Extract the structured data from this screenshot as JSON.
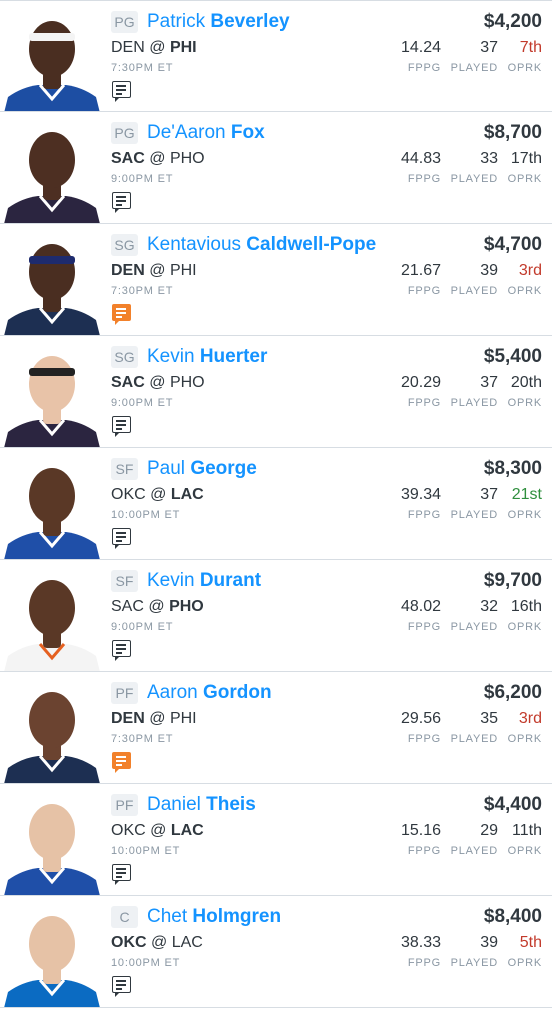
{
  "labels": {
    "fppg": "FPPG",
    "played": "PLAYED",
    "oprk": "OPRK"
  },
  "colors": {
    "jersey": {
      "PHI": "#1d4ea3",
      "SAC": "#2b2540",
      "DEN": "#1d2f52",
      "LAC": "#1f4fa8",
      "PHO": "#f4f4f4",
      "OKC": "#0b6bc2"
    }
  },
  "players": [
    {
      "position": "PG",
      "first": "Patrick",
      "last": "Beverley",
      "salary": "$4,200",
      "away": "DEN",
      "sep": "@",
      "home": "PHI",
      "bold": "home",
      "time": "7:30PM ET",
      "fppg": "14.24",
      "played": "37",
      "oprk": "7th",
      "oprk_tone": "bad",
      "note_active": false,
      "team": "PHI",
      "headband": "white",
      "skin": "#4a2e21"
    },
    {
      "position": "PG",
      "first": "De'Aaron",
      "last": "Fox",
      "salary": "$8,700",
      "away": "SAC",
      "sep": "@",
      "home": "PHO",
      "bold": "away",
      "time": "9:00PM ET",
      "fppg": "44.83",
      "played": "33",
      "oprk": "17th",
      "oprk_tone": "neutral",
      "note_active": false,
      "team": "SAC",
      "headband": "",
      "skin": "#4d2f22"
    },
    {
      "position": "SG",
      "first": "Kentavious",
      "last": "Caldwell-Pope",
      "salary": "$4,700",
      "away": "DEN",
      "sep": "@",
      "home": "PHI",
      "bold": "away",
      "time": "7:30PM ET",
      "fppg": "21.67",
      "played": "39",
      "oprk": "3rd",
      "oprk_tone": "bad",
      "note_active": true,
      "team": "DEN",
      "headband": "navy",
      "skin": "#4a2e21"
    },
    {
      "position": "SG",
      "first": "Kevin",
      "last": "Huerter",
      "salary": "$5,400",
      "away": "SAC",
      "sep": "@",
      "home": "PHO",
      "bold": "away",
      "time": "9:00PM ET",
      "fppg": "20.29",
      "played": "37",
      "oprk": "20th",
      "oprk_tone": "neutral",
      "note_active": false,
      "team": "SAC",
      "headband": "black",
      "skin": "#e8c3a8"
    },
    {
      "position": "SF",
      "first": "Paul",
      "last": "George",
      "salary": "$8,300",
      "away": "OKC",
      "sep": "@",
      "home": "LAC",
      "bold": "home",
      "time": "10:00PM ET",
      "fppg": "39.34",
      "played": "37",
      "oprk": "21st",
      "oprk_tone": "good",
      "note_active": false,
      "team": "LAC",
      "headband": "",
      "skin": "#5a3826"
    },
    {
      "position": "SF",
      "first": "Kevin",
      "last": "Durant",
      "salary": "$9,700",
      "away": "SAC",
      "sep": "@",
      "home": "PHO",
      "bold": "home",
      "time": "9:00PM ET",
      "fppg": "48.02",
      "played": "32",
      "oprk": "16th",
      "oprk_tone": "neutral",
      "note_active": false,
      "team": "PHO",
      "headband": "",
      "skin": "#5a3826"
    },
    {
      "position": "PF",
      "first": "Aaron",
      "last": "Gordon",
      "salary": "$6,200",
      "away": "DEN",
      "sep": "@",
      "home": "PHI",
      "bold": "away",
      "time": "7:30PM ET",
      "fppg": "29.56",
      "played": "35",
      "oprk": "3rd",
      "oprk_tone": "bad",
      "note_active": true,
      "team": "DEN",
      "headband": "",
      "skin": "#6b4330"
    },
    {
      "position": "PF",
      "first": "Daniel",
      "last": "Theis",
      "salary": "$4,400",
      "away": "OKC",
      "sep": "@",
      "home": "LAC",
      "bold": "home",
      "time": "10:00PM ET",
      "fppg": "15.16",
      "played": "29",
      "oprk": "11th",
      "oprk_tone": "neutral",
      "note_active": false,
      "team": "LAC",
      "headband": "",
      "skin": "#e6c2a6"
    },
    {
      "position": "C",
      "first": "Chet",
      "last": "Holmgren",
      "salary": "$8,400",
      "away": "OKC",
      "sep": "@",
      "home": "LAC",
      "bold": "away",
      "time": "10:00PM ET",
      "fppg": "38.33",
      "played": "39",
      "oprk": "5th",
      "oprk_tone": "bad",
      "note_active": false,
      "team": "OKC",
      "headband": "",
      "skin": "#e6c2a6"
    }
  ]
}
